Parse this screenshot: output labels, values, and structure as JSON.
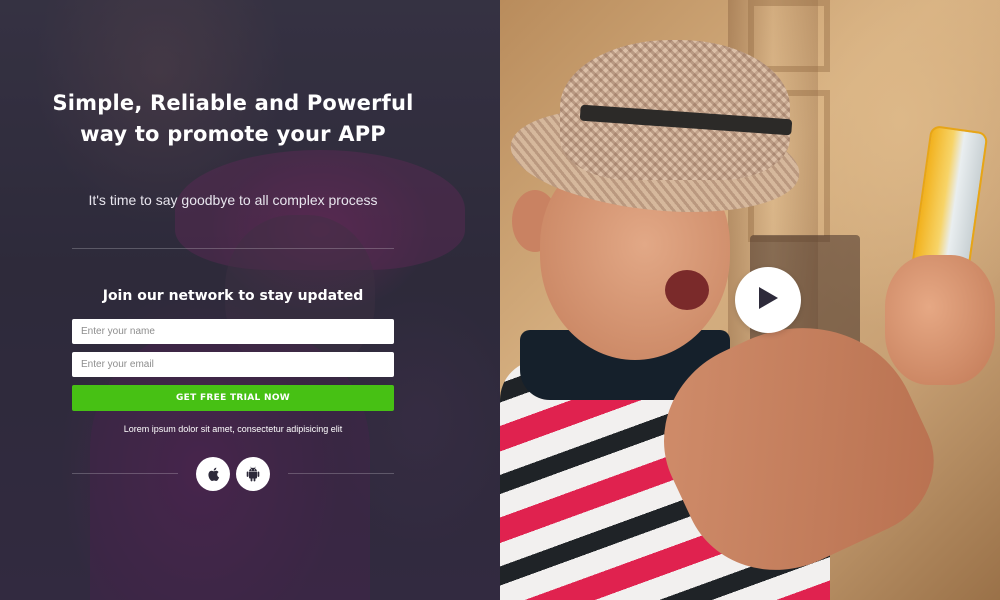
{
  "hero": {
    "headline": "Simple, Reliable and Powerful way to promote your APP",
    "subtitle": "It's time to say goodbye to all complex process"
  },
  "signup": {
    "heading": "Join our network to stay updated",
    "name_placeholder": "Enter your name",
    "email_placeholder": "Enter your email",
    "cta_label": "GET FREE TRIAL NOW",
    "note": "Lorem ipsum dolor sit amet, consectetur adipisicing elit"
  },
  "stores": [
    {
      "icon": "apple-icon"
    },
    {
      "icon": "android-icon"
    }
  ],
  "video": {
    "icon": "play-icon"
  },
  "colors": {
    "cta": "#47c114",
    "overlay": "#2e2a3c",
    "text": "#ffffff",
    "icon_dark": "#2d2a3a"
  }
}
